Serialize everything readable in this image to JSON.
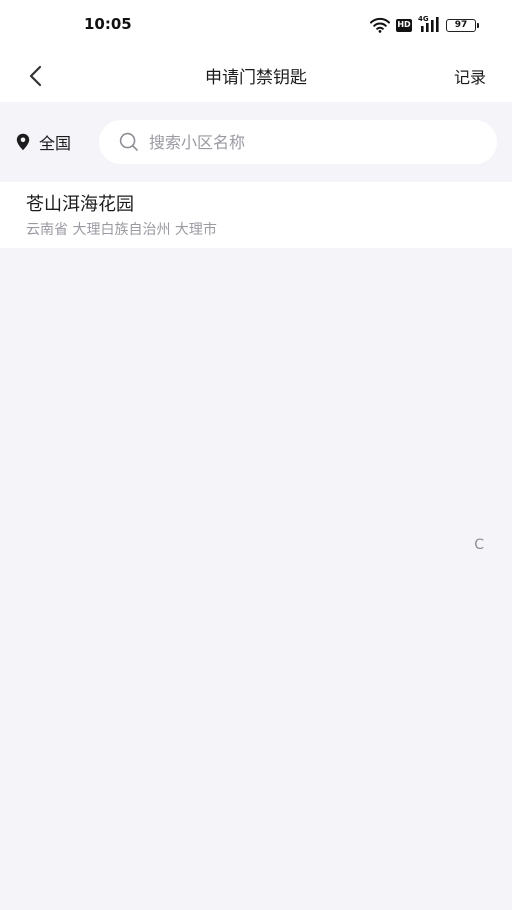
{
  "status_bar": {
    "time": "10:05",
    "network": "4G",
    "hd": "HD",
    "battery": "97"
  },
  "nav": {
    "title": "申请门禁钥匙",
    "action_label": "记录"
  },
  "search": {
    "region_label": "全国",
    "placeholder": "搜索小区名称",
    "value": ""
  },
  "communities": [
    {
      "name": "苍山洱海花园",
      "address": "云南省 大理白族自治州 大理市"
    }
  ],
  "index_letters": [
    "C"
  ],
  "colors": {
    "background": "#f5f5f9",
    "surface": "#ffffff",
    "text_primary": "#1c1c1e",
    "text_secondary": "#9a9aa2"
  }
}
